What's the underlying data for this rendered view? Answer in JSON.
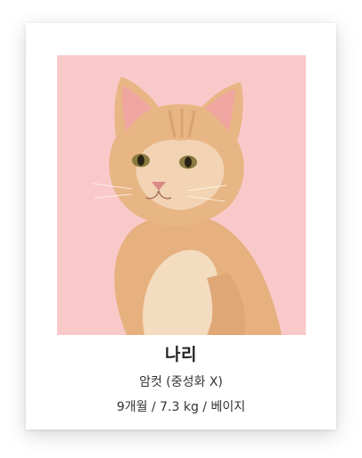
{
  "pet": {
    "name": "나리",
    "sex_line": "암컷 (중성화 X)",
    "info_line": "9개월 / 7.3 kg / 베이지"
  },
  "photo": {
    "subject": "cat-photo",
    "background_color": "#f9c9ca",
    "fur_color": "#e9b98a"
  }
}
